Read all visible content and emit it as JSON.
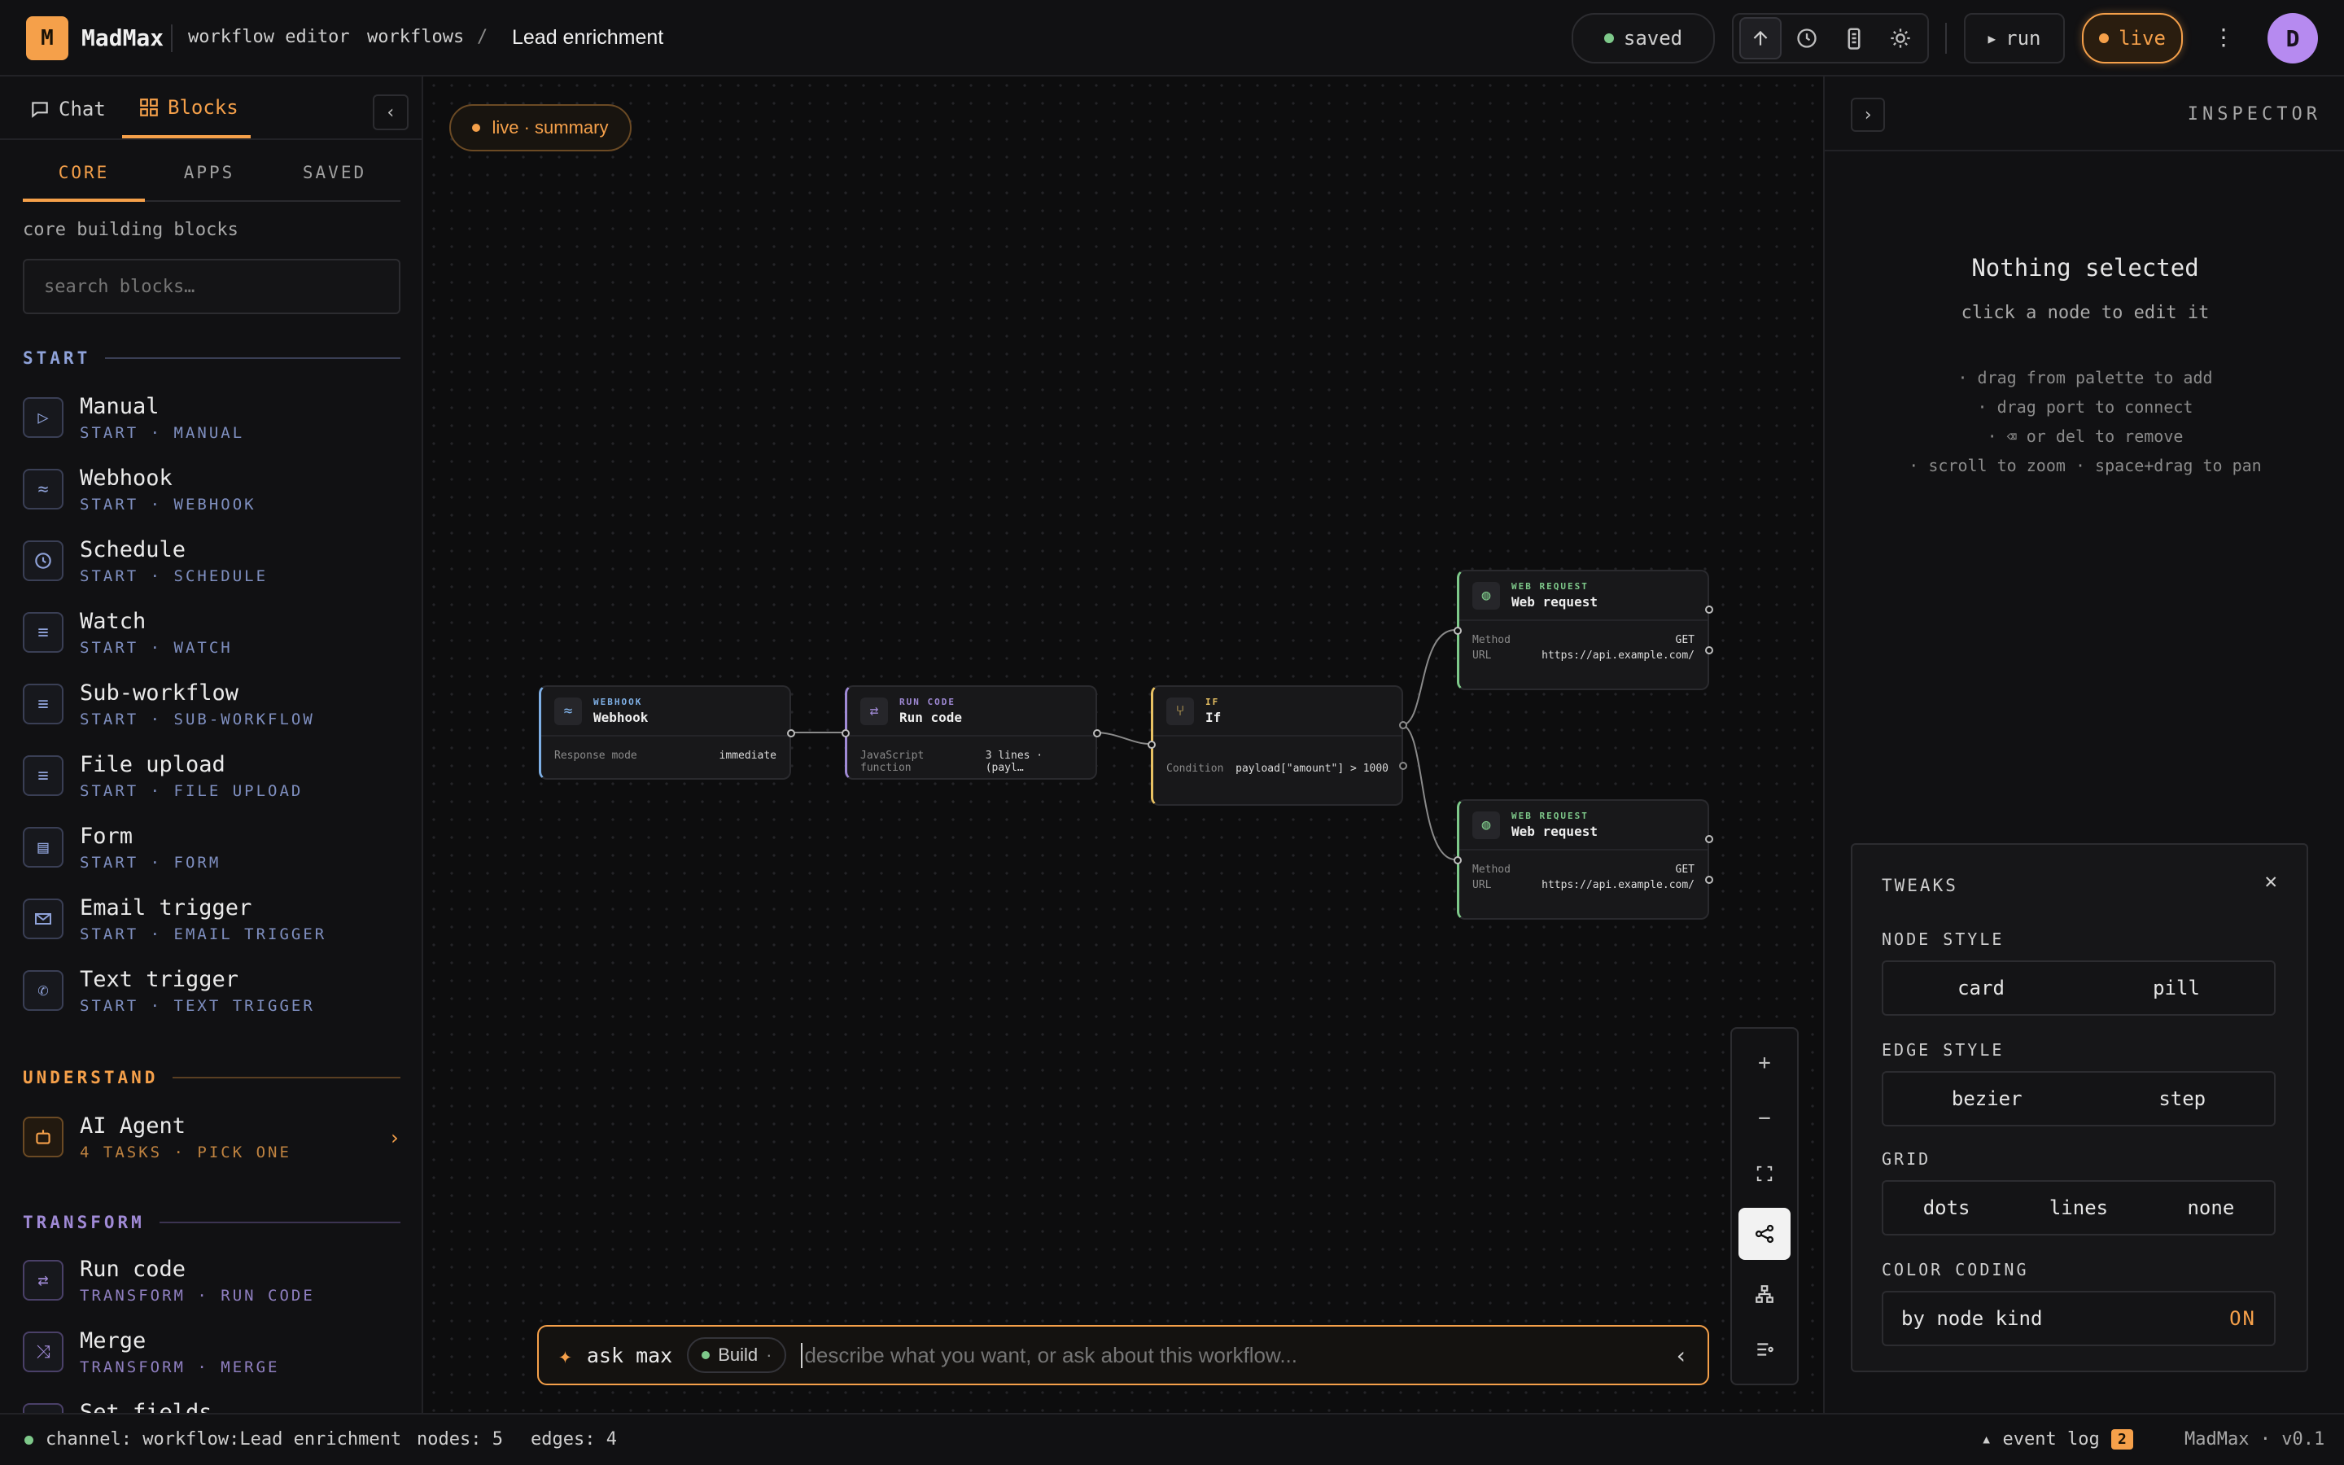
{
  "header": {
    "logo_letter": "M",
    "app_name": "MadMax",
    "app_subtitle": "workflow editor",
    "breadcrumb_root": "workflows",
    "breadcrumb_sep": "/",
    "breadcrumb_current": "Lead enrichment",
    "saved_label": "saved",
    "run_label": "run",
    "live_label": "live",
    "avatar_initial": "D",
    "icons": [
      "upload-icon",
      "history-icon",
      "battery-icon",
      "sun-icon",
      "more-vert-icon"
    ]
  },
  "sidebar": {
    "tabs": [
      {
        "label": "Chat",
        "active": false
      },
      {
        "label": "Blocks",
        "active": true
      }
    ],
    "subtabs": [
      {
        "label": "CORE",
        "active": true
      },
      {
        "label": "APPS",
        "active": false
      },
      {
        "label": "SAVED",
        "active": false
      }
    ],
    "caption": "core building blocks",
    "search_placeholder": "search blocks…",
    "sections": {
      "start": {
        "title": "START",
        "items": [
          {
            "name": "Manual",
            "sub": "START · MANUAL",
            "icon": "play-icon"
          },
          {
            "name": "Webhook",
            "sub": "START · WEBHOOK",
            "icon": "webhook-icon"
          },
          {
            "name": "Schedule",
            "sub": "START · SCHEDULE",
            "icon": "clock-icon"
          },
          {
            "name": "Watch",
            "sub": "START · WATCH",
            "icon": "doc-icon"
          },
          {
            "name": "Sub-workflow",
            "sub": "START · SUB-WORKFLOW",
            "icon": "doc-icon"
          },
          {
            "name": "File upload",
            "sub": "START · FILE UPLOAD",
            "icon": "doc-icon"
          },
          {
            "name": "Form",
            "sub": "START · FORM",
            "icon": "form-icon"
          },
          {
            "name": "Email trigger",
            "sub": "START · EMAIL TRIGGER",
            "icon": "mail-icon"
          },
          {
            "name": "Text trigger",
            "sub": "START · TEXT TRIGGER",
            "icon": "phone-icon"
          }
        ]
      },
      "understand": {
        "title": "UNDERSTAND",
        "items": [
          {
            "name": "AI Agent",
            "sub": "4 TASKS · PICK ONE",
            "icon": "robot-icon",
            "chevron": "›"
          }
        ]
      },
      "transform": {
        "title": "TRANSFORM",
        "items": [
          {
            "name": "Run code",
            "sub": "TRANSFORM · RUN CODE",
            "icon": "code-icon"
          },
          {
            "name": "Merge",
            "sub": "TRANSFORM · MERGE",
            "icon": "merge-icon"
          },
          {
            "name": "Set fields",
            "sub": "",
            "icon": "doc-icon"
          }
        ]
      }
    }
  },
  "canvas": {
    "live_summary_label": "live · summary",
    "nodes": {
      "webhook": {
        "kind": "WEBHOOK",
        "title": "Webhook",
        "rows": [
          {
            "k": "Response mode",
            "v": "immediate"
          }
        ]
      },
      "runcode": {
        "kind": "RUN CODE",
        "title": "Run code",
        "rows": [
          {
            "k": "JavaScript function",
            "v": "3 lines · (payl…"
          }
        ]
      },
      "if": {
        "kind": "IF",
        "title": "If",
        "rows": [
          {
            "k": "Condition",
            "v": "payload[\"amount\"] > 1000"
          }
        ]
      },
      "web1": {
        "kind": "WEB REQUEST",
        "title": "Web request",
        "rows": [
          {
            "k": "Method",
            "v": "GET"
          },
          {
            "k": "URL",
            "v": "https://api.example.com/"
          }
        ]
      },
      "web2": {
        "kind": "WEB REQUEST",
        "title": "Web request",
        "rows": [
          {
            "k": "Method",
            "v": "GET"
          },
          {
            "k": "URL",
            "v": "https://api.example.com/"
          }
        ]
      }
    },
    "ask": {
      "label": "ask max",
      "mode": "Build",
      "mode_caret": "·",
      "placeholder": "describe what you want, or ask about this workflow..."
    },
    "controls": [
      "zoom-in-icon",
      "zoom-out-icon",
      "fit-icon",
      "share-graph-icon",
      "hierarchy-icon",
      "list-settings-icon"
    ]
  },
  "inspector": {
    "title": "INSPECTOR",
    "empty_title": "Nothing selected",
    "empty_sub": "click a node to edit it",
    "tips": [
      "· drag from palette to add",
      "· drag port to connect",
      "· ⌫ or del to remove",
      "· scroll to zoom · space+drag to pan"
    ]
  },
  "tweaks": {
    "title": "TWEAKS",
    "node_style": {
      "label": "NODE STYLE",
      "options": [
        "card",
        "pill"
      ]
    },
    "edge_style": {
      "label": "EDGE STYLE",
      "options": [
        "bezier",
        "step"
      ]
    },
    "grid": {
      "label": "GRID",
      "options": [
        "dots",
        "lines",
        "none"
      ]
    },
    "color_coding": {
      "label": "COLOR CODING",
      "value": "by node kind",
      "state": "ON"
    }
  },
  "statusbar": {
    "channel": "channel: workflow:Lead enrichment",
    "nodes": "nodes: 5",
    "edges": "edges: 4",
    "event_log": "▴ event log",
    "event_count": "2",
    "version": "MadMax · v0.1"
  },
  "colors": {
    "accent": "#f5a04a",
    "webhook_blue": "#7fb0e6",
    "code_purple": "#a08ad6",
    "if_yellow": "#e8c163",
    "web_green": "#7ec98a",
    "status_green": "#7ec98a"
  }
}
